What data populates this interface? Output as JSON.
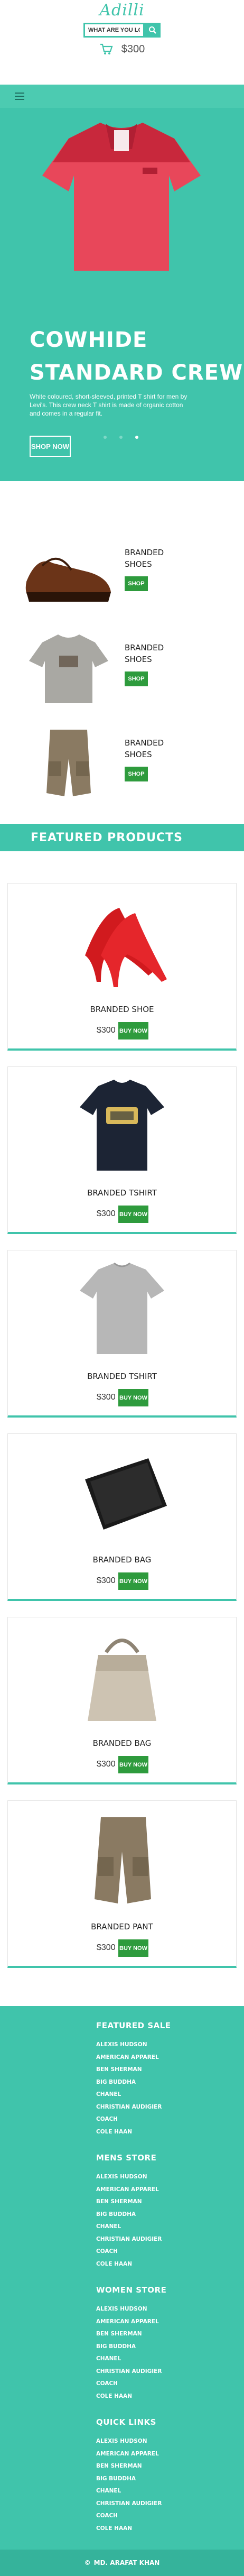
{
  "header": {
    "logo": "Adilli",
    "search": {
      "value": "WHAT ARE YOU LOO",
      "placeholder": ""
    },
    "cart_total": "$300"
  },
  "hero": {
    "title_line1": "COWHIDE",
    "title_line2": "STANDARD CREW",
    "description": "White coloured, short-sleeved, printed T shirt for men by Levi's. This crew neck T shirt is made of organic cotton and comes in a regular fit.",
    "button_label": "SHOP NOW",
    "slides": 3,
    "active_slide": 3
  },
  "side_products": [
    {
      "label_line1": "BRANDED",
      "label_line2": "SHOES",
      "button": "SHOP",
      "icon": "brown-shoe-image"
    },
    {
      "label_line1": "BRANDED",
      "label_line2": "SHOES",
      "button": "SHOP",
      "icon": "grey-tshirt-image"
    },
    {
      "label_line1": "BRANDED",
      "label_line2": "SHOES",
      "button": "SHOP",
      "icon": "cargo-shorts-image"
    }
  ],
  "featured": {
    "title": "FEATURED PRODUCTS",
    "products": [
      {
        "name": "BRANDED SHOE",
        "price": "$300",
        "button": "BUY NOW",
        "icon": "red-heels-image"
      },
      {
        "name": "BRANDED TSHIRT",
        "price": "$300",
        "button": "BUY NOW",
        "icon": "navy-tshirt-image"
      },
      {
        "name": "BRANDED TSHIRT",
        "price": "$300",
        "button": "BUY NOW",
        "icon": "grey-tshirt-image"
      },
      {
        "name": "BRANDED BAG",
        "price": "$300",
        "button": "BUY NOW",
        "icon": "black-wallet-image"
      },
      {
        "name": "BRANDED BAG",
        "price": "$300",
        "button": "BUY NOW",
        "icon": "beige-handbag-image"
      },
      {
        "name": "BRANDED PANT",
        "price": "$300",
        "button": "BUY NOW",
        "icon": "cargo-shorts-image"
      }
    ]
  },
  "footer": {
    "sections": [
      {
        "heading": "FEATURED SALE",
        "links": [
          "ALEXIS HUDSON",
          "AMERICAN APPAREL",
          "BEN SHERMAN",
          "BIG BUDDHA",
          "CHANEL",
          "CHRISTIAN AUDIGIER",
          "COACH",
          "COLE HAAN"
        ]
      },
      {
        "heading": "MENS STORE",
        "links": [
          "ALEXIS HUDSON",
          "AMERICAN APPAREL",
          "BEN SHERMAN",
          "BIG BUDDHA",
          "CHANEL",
          "CHRISTIAN AUDIGIER",
          "COACH",
          "COLE HAAN"
        ]
      },
      {
        "heading": "WOMEN STORE",
        "links": [
          "ALEXIS HUDSON",
          "AMERICAN APPAREL",
          "BEN SHERMAN",
          "BIG BUDDHA",
          "CHANEL",
          "CHRISTIAN AUDIGIER",
          "COACH",
          "COLE HAAN"
        ]
      },
      {
        "heading": "QUICK LINKS",
        "links": [
          "ALEXIS HUDSON",
          "AMERICAN APPAREL",
          "BEN SHERMAN",
          "BIG BUDDHA",
          "CHANEL",
          "CHRISTIAN AUDIGIER",
          "COACH",
          "COLE HAAN"
        ]
      }
    ],
    "copyright": "MD. ARAFAT KHAN"
  },
  "colors": {
    "accent": "#40c4ab",
    "button_green": "#2e9b3d",
    "hero_shirt": "#e8475a"
  }
}
